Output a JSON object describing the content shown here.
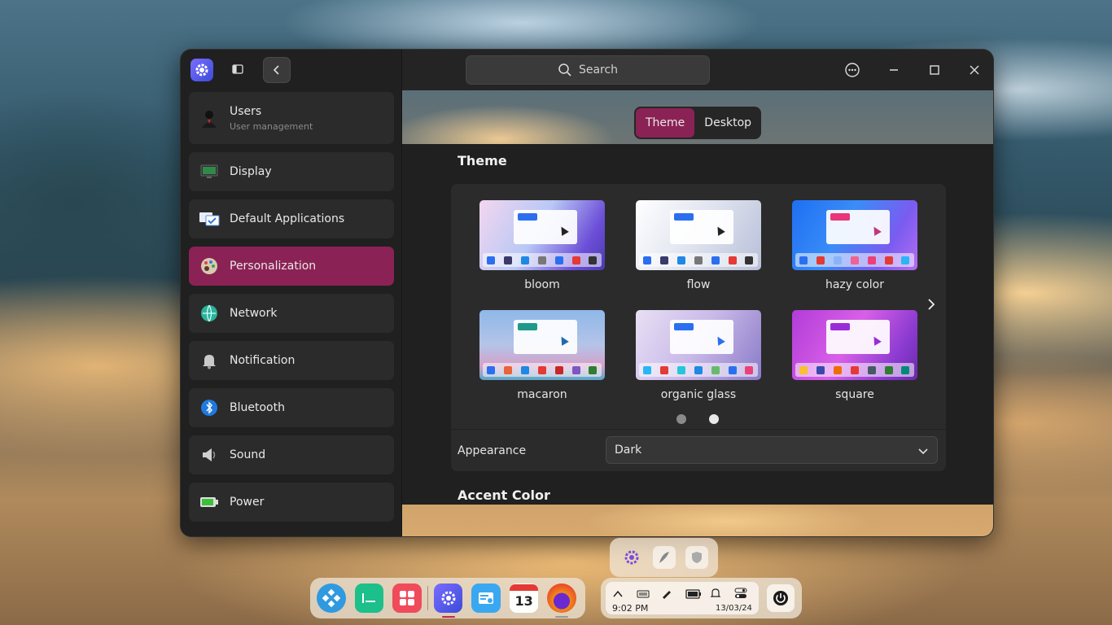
{
  "header": {
    "search_placeholder": "Search"
  },
  "sidebar": {
    "items": [
      {
        "label": "Users",
        "sublabel": "User management",
        "icon": "user-icon"
      },
      {
        "label": "Display",
        "icon": "display-icon"
      },
      {
        "label": "Default Applications",
        "icon": "default-apps-icon"
      },
      {
        "label": "Personalization",
        "icon": "palette-icon",
        "active": true
      },
      {
        "label": "Network",
        "icon": "network-icon"
      },
      {
        "label": "Notification",
        "icon": "bell-icon"
      },
      {
        "label": "Bluetooth",
        "icon": "bluetooth-icon"
      },
      {
        "label": "Sound",
        "icon": "speaker-icon"
      },
      {
        "label": "Power",
        "icon": "battery-icon"
      }
    ]
  },
  "tabs": [
    {
      "label": "Theme",
      "active": true
    },
    {
      "label": "Desktop",
      "active": false
    }
  ],
  "theme_section": {
    "title": "Theme",
    "themes": [
      {
        "label": "bloom"
      },
      {
        "label": "flow"
      },
      {
        "label": "hazy color"
      },
      {
        "label": "macaron"
      },
      {
        "label": "organic glass"
      },
      {
        "label": "square"
      }
    ],
    "page_count": 2,
    "current_page": 2
  },
  "appearance": {
    "label": "Appearance",
    "value": "Dark"
  },
  "accent_section": {
    "title": "Accent Color"
  },
  "taskbar": {
    "time": "9:02 PM",
    "date": "13/03/24",
    "calendar_day": "13"
  },
  "colors": {
    "accent": "#8b2255",
    "sidebar_bg": "#202020",
    "item_bg": "#2b2b2b"
  }
}
